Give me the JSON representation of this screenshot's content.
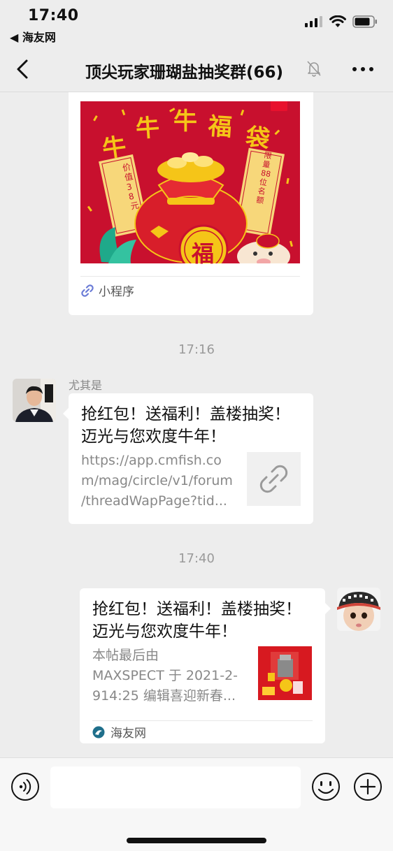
{
  "status_bar": {
    "time": "17:40",
    "back_app": "◀ 海友网"
  },
  "nav": {
    "title": "顶尖玩家珊瑚盐抽奖群(66)"
  },
  "messages": [
    {
      "type": "mini_program",
      "poster": {
        "title_chars": [
          "牛",
          "牛",
          "牛",
          "福",
          "袋"
        ],
        "left_note": "价值38元",
        "right_note": "限量88位名额",
        "center_char": "福"
      },
      "footer_label": "小程序"
    },
    {
      "type": "timestamp",
      "text": "17:16"
    },
    {
      "type": "link",
      "sender": "尤其是",
      "title": "抢红包！送福利！盖楼抽奖！迈光与您欢度牛年！",
      "description": "https://app.cmfish.co\nm/mag/circle/v1/forum\n/threadWapPage?tid..."
    },
    {
      "type": "timestamp",
      "text": "17:40"
    },
    {
      "type": "link",
      "sender": "",
      "title": "抢红包！送福利！盖楼抽奖！迈光与您欢度牛年！",
      "description": "本帖最后由\nMAXSPECT 于 2021-2-\n914:25 编辑喜迎新春...",
      "source_label": "海友网"
    }
  ],
  "colors": {
    "chat_bg": "#ededed",
    "bubble": "#ffffff",
    "poster_red": "#c8102e",
    "gold": "#f5c518",
    "link_icon": "#6a7bd6"
  },
  "icons": [
    "signal-icon",
    "wifi-icon",
    "battery-icon",
    "back-chevron-icon",
    "mute-bell-icon",
    "more-dots-icon",
    "link-icon",
    "voice-icon",
    "emoji-icon",
    "plus-icon"
  ]
}
